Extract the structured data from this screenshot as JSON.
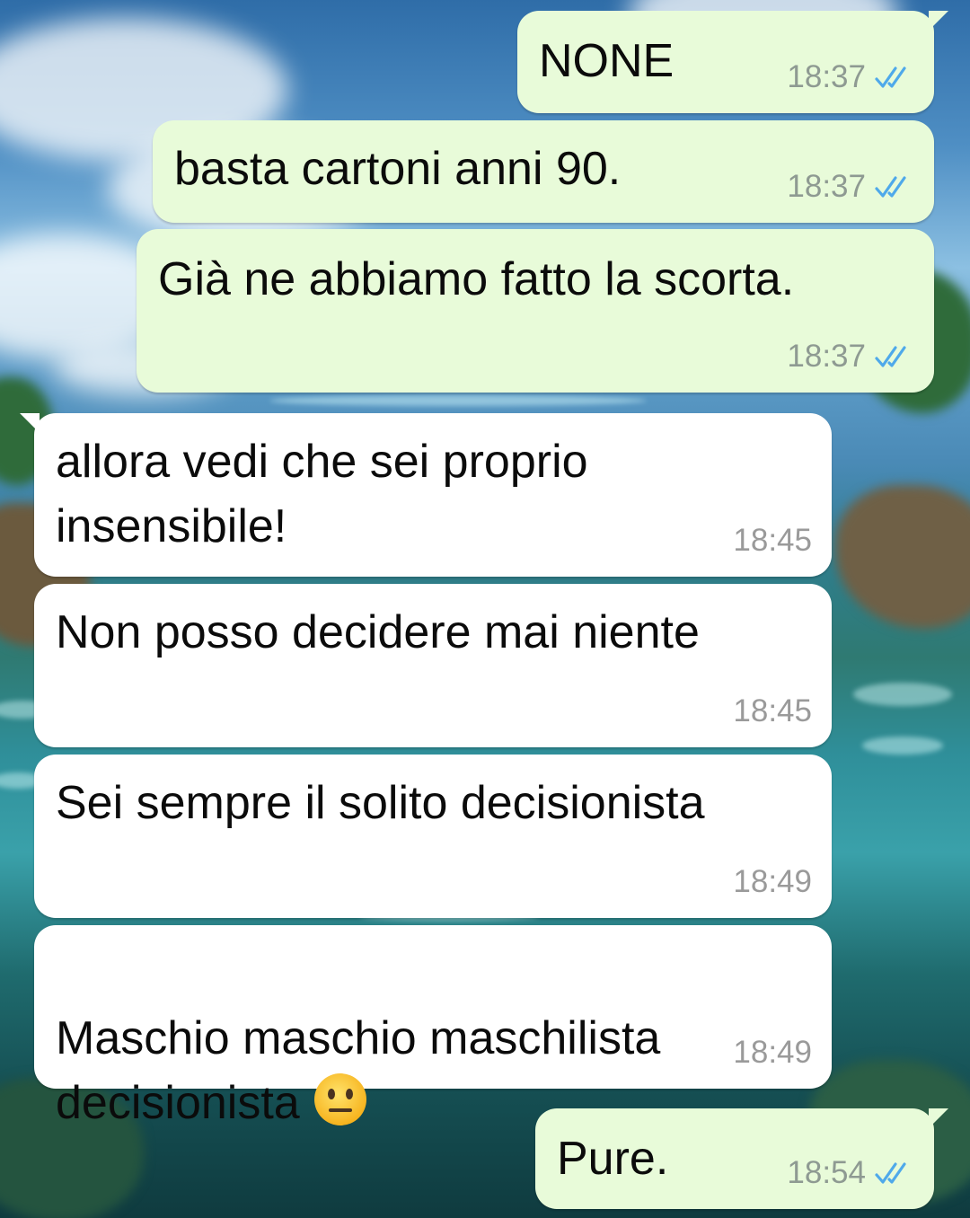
{
  "conversation": {
    "messages": [
      {
        "direction": "out",
        "text": "NONE",
        "time": "18:37",
        "status_icon": "double-check-read-icon"
      },
      {
        "direction": "out",
        "text": "basta cartoni anni 90.",
        "time": "18:37",
        "status_icon": "double-check-read-icon"
      },
      {
        "direction": "out",
        "text": "Già ne abbiamo fatto la scorta.",
        "time": "18:37",
        "status_icon": "double-check-read-icon"
      },
      {
        "direction": "in",
        "text": "allora vedi che sei proprio\ninsensibile!",
        "time": "18:45"
      },
      {
        "direction": "in",
        "text": "Non posso decidere mai niente",
        "time": "18:45"
      },
      {
        "direction": "in",
        "text": "Sei sempre il solito decisionista",
        "time": "18:49"
      },
      {
        "direction": "in",
        "text": "Maschio maschio maschilista\ndecisionista",
        "time": "18:49",
        "emoji": "neutral-face-icon"
      },
      {
        "direction": "out",
        "text": "Pure.",
        "time": "18:54",
        "status_icon": "double-check-read-icon"
      }
    ]
  },
  "colors": {
    "outgoing_bubble": "#e8fbd9",
    "incoming_bubble": "#ffffff",
    "read_check": "#4fa9ea"
  }
}
